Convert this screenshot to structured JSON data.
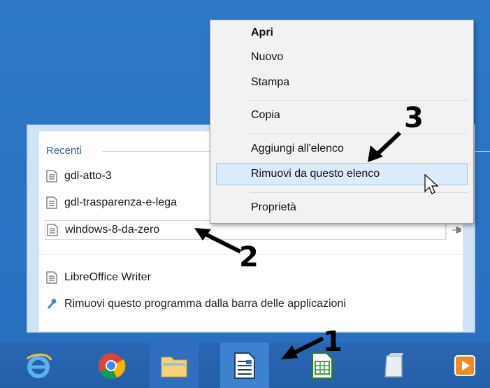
{
  "jumplist": {
    "section_title": "Recenti",
    "recent_items": [
      {
        "label": "gdl-atto-3"
      },
      {
        "label": "gdl-trasparenza-e-lega"
      },
      {
        "label": "windows-8-da-zero"
      }
    ],
    "app_name": "LibreOffice Writer",
    "unpin_label": "Rimuovi questo programma dalla barra delle applicazioni"
  },
  "context_menu": {
    "items": [
      {
        "label": "Apri"
      },
      {
        "label": "Nuovo"
      },
      {
        "label": "Stampa"
      },
      {
        "label": "Copia"
      },
      {
        "label": "Aggiungi all'elenco"
      },
      {
        "label": "Rimuovi da questo elenco"
      },
      {
        "label": "Proprietà"
      }
    ]
  },
  "taskbar": {
    "apps": [
      "internet-explorer-icon",
      "chrome-icon",
      "file-explorer-icon",
      "libreoffice-writer-icon",
      "libreoffice-calc-icon",
      "notepad-icon",
      "media-player-icon"
    ]
  },
  "annotations": {
    "step1": "1",
    "step2": "2",
    "step3": "3"
  },
  "colors": {
    "accent": "#2b5fa6",
    "highlight": "#dcebfc",
    "taskbar": "#255fa8"
  }
}
